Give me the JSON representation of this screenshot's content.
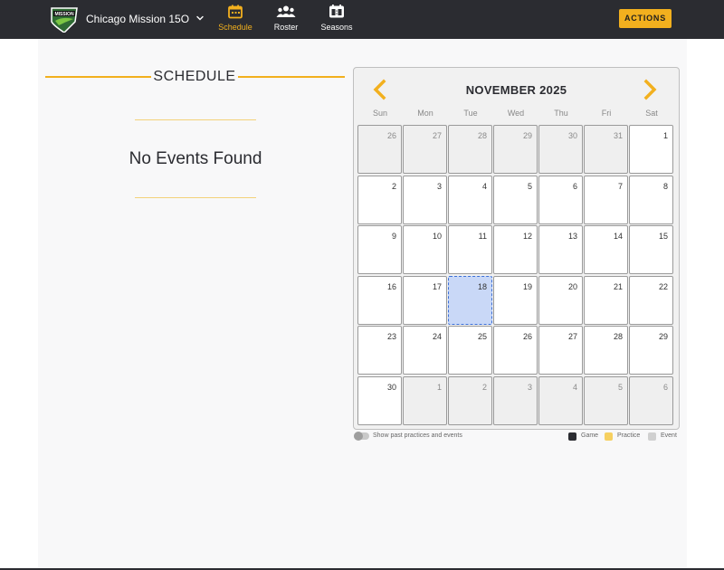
{
  "header": {
    "team_name": "Chicago Mission 15O",
    "logo_text": "MISSION",
    "nav": [
      {
        "label": "Schedule",
        "icon": "calendar-icon",
        "active": true
      },
      {
        "label": "Roster",
        "icon": "people-icon",
        "active": false
      },
      {
        "label": "Seasons",
        "icon": "scoreboard-icon",
        "active": false
      }
    ],
    "actions_label": "ACTIONS",
    "accent_color": "#f2b01e",
    "bar_color": "#2b2c31"
  },
  "schedule": {
    "title": "SCHEDULE",
    "empty_message": "No Events Found"
  },
  "calendar": {
    "month_label": "NOVEMBER 2025",
    "weekdays": [
      "Sun",
      "Mon",
      "Tue",
      "Wed",
      "Thu",
      "Fri",
      "Sat"
    ],
    "today": 18,
    "today_color": "#c9d8f7",
    "weeks": [
      [
        {
          "d": "26",
          "other": true
        },
        {
          "d": "27",
          "other": true
        },
        {
          "d": "28",
          "other": true
        },
        {
          "d": "29",
          "other": true
        },
        {
          "d": "30",
          "other": true
        },
        {
          "d": "31",
          "other": true
        },
        {
          "d": "1",
          "other": false
        }
      ],
      [
        {
          "d": "2",
          "other": false
        },
        {
          "d": "3",
          "other": false
        },
        {
          "d": "4",
          "other": false
        },
        {
          "d": "5",
          "other": false
        },
        {
          "d": "6",
          "other": false
        },
        {
          "d": "7",
          "other": false
        },
        {
          "d": "8",
          "other": false
        }
      ],
      [
        {
          "d": "9",
          "other": false
        },
        {
          "d": "10",
          "other": false
        },
        {
          "d": "11",
          "other": false
        },
        {
          "d": "12",
          "other": false
        },
        {
          "d": "13",
          "other": false
        },
        {
          "d": "14",
          "other": false
        },
        {
          "d": "15",
          "other": false
        }
      ],
      [
        {
          "d": "16",
          "other": false
        },
        {
          "d": "17",
          "other": false
        },
        {
          "d": "18",
          "other": false
        },
        {
          "d": "19",
          "other": false
        },
        {
          "d": "20",
          "other": false
        },
        {
          "d": "21",
          "other": false
        },
        {
          "d": "22",
          "other": false
        }
      ],
      [
        {
          "d": "23",
          "other": false
        },
        {
          "d": "24",
          "other": false
        },
        {
          "d": "25",
          "other": false
        },
        {
          "d": "26",
          "other": false
        },
        {
          "d": "27",
          "other": false
        },
        {
          "d": "28",
          "other": false
        },
        {
          "d": "29",
          "other": false
        }
      ],
      [
        {
          "d": "30",
          "other": false
        },
        {
          "d": "1",
          "other": true
        },
        {
          "d": "2",
          "other": true
        },
        {
          "d": "3",
          "other": true
        },
        {
          "d": "4",
          "other": true
        },
        {
          "d": "5",
          "other": true
        },
        {
          "d": "6",
          "other": true
        }
      ]
    ]
  },
  "footer": {
    "toggle_label": "Show past practices and events",
    "toggle_on": false,
    "legend": [
      {
        "label": "Game",
        "color": "#2b2c31"
      },
      {
        "label": "Practice",
        "color": "#f6d060"
      },
      {
        "label": "Event",
        "color": "#d0d0d0"
      }
    ]
  }
}
